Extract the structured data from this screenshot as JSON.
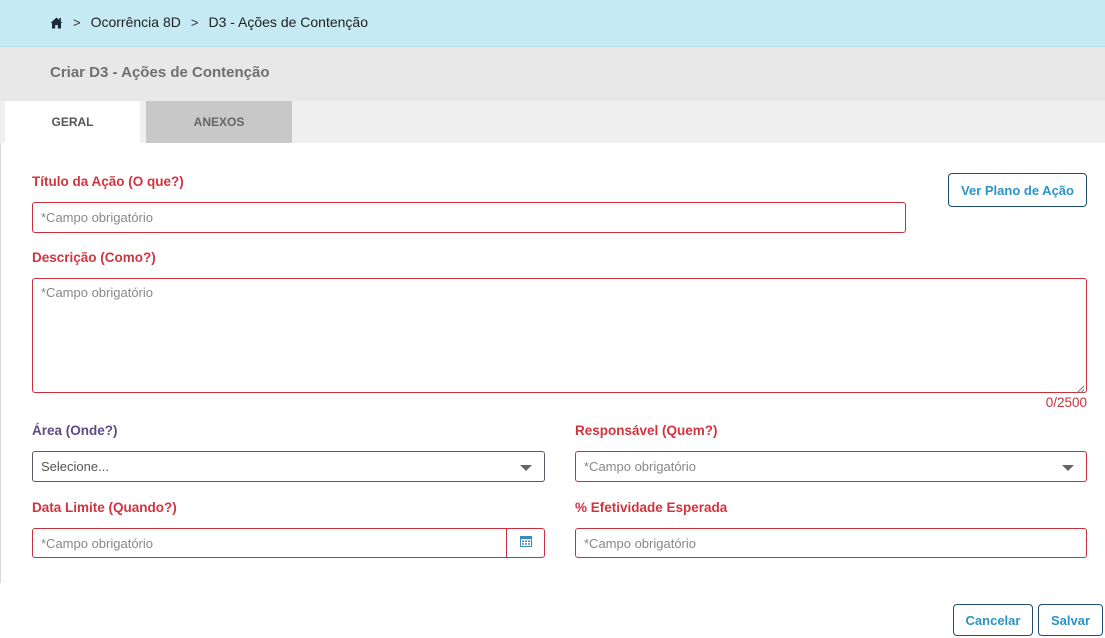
{
  "breadcrumb": {
    "home_icon": "home-icon",
    "separator": ">",
    "items": [
      "Ocorrência 8D",
      "D3 - Ações de Contenção"
    ]
  },
  "page_title": "Criar D3 - Ações de Contenção",
  "tabs": [
    {
      "label": "GERAL",
      "active": true
    },
    {
      "label": "ANEXOS",
      "active": false
    }
  ],
  "form": {
    "titulo": {
      "label": "Título da Ação (O que?)",
      "placeholder": "*Campo obrigatório"
    },
    "ver_plano_button": "Ver Plano de Ação",
    "descricao": {
      "label": "Descrição (Como?)",
      "placeholder": "*Campo obrigatório",
      "counter": "0/2500"
    },
    "area": {
      "label": "Área (Onde?)",
      "placeholder": "Selecione..."
    },
    "responsavel": {
      "label": "Responsável (Quem?)",
      "placeholder": "*Campo obrigatório"
    },
    "data_limite": {
      "label": "Data Limite (Quando?)",
      "placeholder": "*Campo obrigatório",
      "icon": "calendar-icon"
    },
    "efetividade": {
      "label": "% Efetividade Esperada",
      "placeholder": "*Campo obrigatório"
    }
  },
  "actions": {
    "cancel_label": "Cancelar",
    "save_label": "Salvar"
  },
  "colors": {
    "breadcrumb_bg": "#c6eaf4",
    "required_red": "#d0343f",
    "optional_purple": "#5d4a86",
    "button_text": "#2a93c8",
    "button_border": "#1d4e72"
  }
}
